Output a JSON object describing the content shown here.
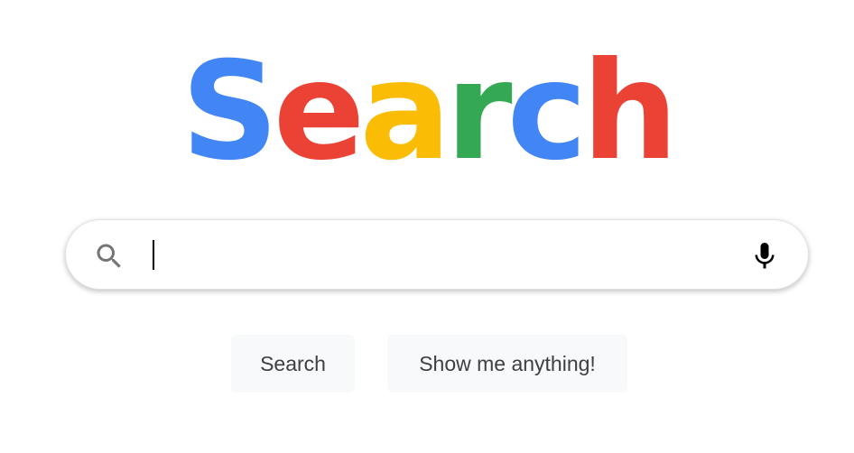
{
  "logo": {
    "letters": [
      {
        "char": "S",
        "color": "#4285f4"
      },
      {
        "char": "e",
        "color": "#ea4335"
      },
      {
        "char": "a",
        "color": "#fbbc05"
      },
      {
        "char": "r",
        "color": "#34a853"
      },
      {
        "char": "c",
        "color": "#4285f4"
      },
      {
        "char": "h",
        "color": "#ea4335"
      }
    ]
  },
  "search": {
    "value": "",
    "left_icon": "search-icon",
    "right_icon": "microphone-icon"
  },
  "buttons": {
    "search_label": "Search",
    "lucky_label": "Show me anything!"
  }
}
